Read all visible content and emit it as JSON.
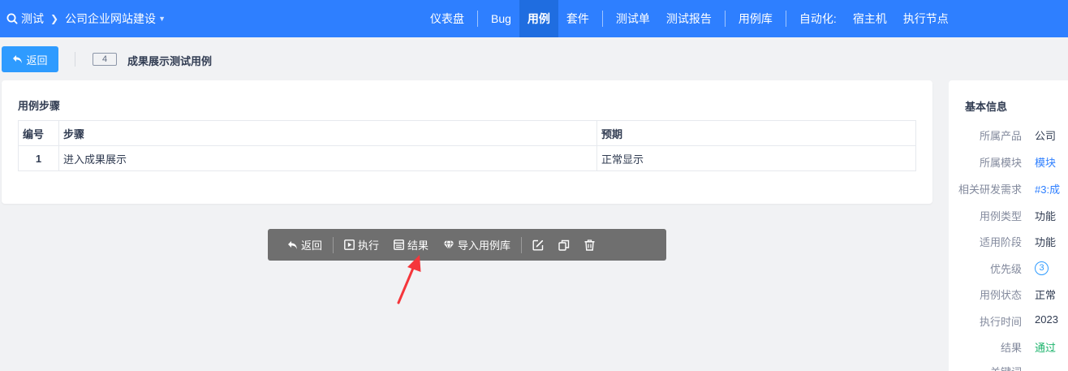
{
  "topnav": {
    "product": "测试",
    "project": "公司企业网站建设",
    "menu": [
      {
        "label": "仪表盘"
      },
      {
        "label": "Bug"
      },
      {
        "label": "用例"
      },
      {
        "label": "套件"
      },
      {
        "label": "测试单"
      },
      {
        "label": "测试报告"
      },
      {
        "label": "用例库"
      },
      {
        "label": "自动化:"
      },
      {
        "label": "宿主机"
      },
      {
        "label": "执行节点"
      }
    ]
  },
  "header": {
    "back_label": "返回",
    "case_id": "4",
    "case_title": "成果展示测试用例"
  },
  "steps": {
    "section_title": "用例步骤",
    "columns": [
      "编号",
      "步骤",
      "预期"
    ],
    "rows": [
      {
        "num": "1",
        "step": "进入成果展示",
        "expect": "正常显示"
      }
    ]
  },
  "toolbar": {
    "back": "返回",
    "run": "执行",
    "result": "结果",
    "import": "导入用例库"
  },
  "info": {
    "title": "基本信息",
    "rows": [
      {
        "label": "所属产品",
        "value": "公司"
      },
      {
        "label": "所属模块",
        "value": "模块"
      },
      {
        "label": "相关研发需求",
        "value": "#3:成"
      },
      {
        "label": "用例类型",
        "value": "功能"
      },
      {
        "label": "适用阶段",
        "value": "功能"
      },
      {
        "label": "优先级",
        "value": "3"
      },
      {
        "label": "用例状态",
        "value": "正常"
      },
      {
        "label": "执行时间",
        "value": "2023"
      },
      {
        "label": "结果",
        "value": "通过"
      },
      {
        "label": "关键词",
        "value": ""
      }
    ]
  },
  "colors": {
    "nav": "#2e7fff",
    "nav_active": "#1f6de0",
    "button": "#2e9bff",
    "toolbar": "#6f6f6f",
    "arrow": "#f5363b",
    "pass": "#1bb36b"
  }
}
